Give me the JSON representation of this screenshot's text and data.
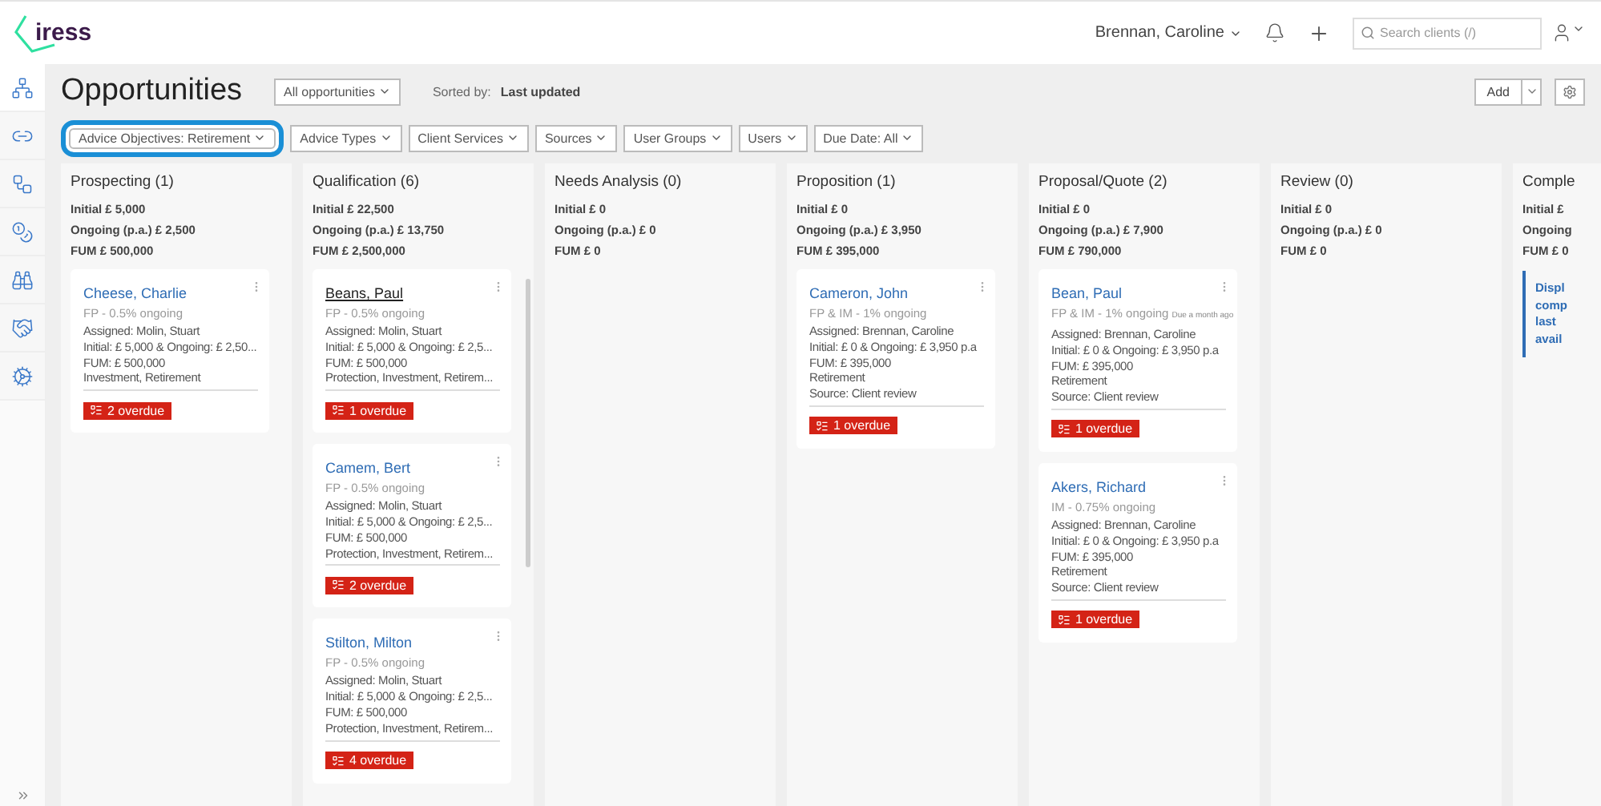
{
  "header": {
    "logo": "iress",
    "user": "Brennan, Caroline",
    "search": {
      "placeholder": "Search clients (/)"
    }
  },
  "title": "Opportunities",
  "view_select": "All opportunities",
  "sorted_label": "Sorted by:",
  "sorted_value": "Last updated",
  "add_button": "Add",
  "filters": [
    {
      "label": "Advice Objectives: Retirement",
      "highlighted": true
    },
    {
      "label": "Advice Types",
      "highlighted": false
    },
    {
      "label": "Client Services",
      "highlighted": false
    },
    {
      "label": "Sources",
      "highlighted": false
    },
    {
      "label": "User Groups",
      "highlighted": false
    },
    {
      "label": "Users",
      "highlighted": false
    },
    {
      "label": "Due Date: All",
      "highlighted": false
    }
  ],
  "columns": [
    {
      "title": "Prospecting (1)",
      "totals": [
        "Initial £ 5,000",
        "Ongoing (p.a.) £ 2,500",
        "FUM £ 500,000"
      ],
      "scrollbar": false,
      "cards": [
        {
          "name": "Cheese, Charlie",
          "hovered": false,
          "subtitle": "FP - 0.5% ongoing",
          "lines": [
            "Assigned: Molin, Stuart",
            "Initial: £ 5,000 & Ongoing: £ 2,50...",
            "FUM: £ 500,000",
            "Investment, Retirement"
          ],
          "overdue": "2 overdue"
        }
      ]
    },
    {
      "title": "Qualification (6)",
      "totals": [
        "Initial £ 22,500",
        "Ongoing (p.a.) £ 13,750",
        "FUM £ 2,500,000"
      ],
      "scrollbar": true,
      "cards": [
        {
          "name": "Beans, Paul",
          "hovered": true,
          "subtitle": "FP - 0.5% ongoing",
          "lines": [
            "Assigned: Molin, Stuart",
            "Initial: £ 5,000 & Ongoing: £ 2,5...",
            "FUM: £ 500,000",
            "Protection, Investment, Retirem..."
          ],
          "overdue": "1 overdue"
        },
        {
          "name": "Camem, Bert",
          "hovered": false,
          "subtitle": "FP - 0.5% ongoing",
          "lines": [
            "Assigned: Molin, Stuart",
            "Initial: £ 5,000 & Ongoing: £ 2,5...",
            "FUM: £ 500,000",
            "Protection, Investment, Retirem..."
          ],
          "overdue": "2 overdue"
        },
        {
          "name": "Stilton, Milton",
          "hovered": false,
          "subtitle": "FP - 0.5% ongoing",
          "lines": [
            "Assigned: Molin, Stuart",
            "Initial: £ 5,000 & Ongoing: £ 2,5...",
            "FUM: £ 500,000",
            "Protection, Investment, Retirem..."
          ],
          "overdue": "4 overdue"
        }
      ]
    },
    {
      "title": "Needs Analysis (0)",
      "totals": [
        "Initial £ 0",
        "Ongoing (p.a.) £ 0",
        "FUM £ 0"
      ],
      "scrollbar": false
    },
    {
      "title": "Proposition (1)",
      "totals": [
        "Initial £ 0",
        "Ongoing (p.a.) £ 3,950",
        "FUM £ 395,000"
      ],
      "scrollbar": false,
      "cards": [
        {
          "name": "Cameron, John",
          "hovered": false,
          "subtitle": "FP & IM - 1% ongoing",
          "lines": [
            "Assigned: Brennan, Caroline",
            "Initial: £ 0 & Ongoing: £ 3,950 p.a",
            "FUM: £ 395,000",
            "Retirement",
            "Source: Client review"
          ],
          "overdue": "1 overdue"
        }
      ]
    },
    {
      "title": "Proposal/Quote (2)",
      "totals": [
        "Initial £ 0",
        "Ongoing (p.a.) £ 7,900",
        "FUM £ 790,000"
      ],
      "scrollbar": false,
      "cards": [
        {
          "name": "Bean, Paul",
          "hovered": false,
          "subtitle": "FP & IM - 1% ongoing",
          "due": "Due a month ago",
          "lines": [
            "Assigned: Brennan, Caroline",
            "Initial: £ 0 & Ongoing: £ 3,950 p.a",
            "FUM: £ 395,000",
            "Retirement",
            "Source: Client review"
          ],
          "overdue": "1 overdue"
        },
        {
          "name": "Akers, Richard",
          "hovered": false,
          "subtitle": "IM - 0.75% ongoing",
          "lines": [
            "Assigned: Brennan, Caroline",
            "Initial: £ 0 & Ongoing: £ 3,950 p.a",
            "FUM: £ 395,000",
            "Retirement",
            "Source: Client review"
          ],
          "overdue": "1 overdue"
        }
      ]
    },
    {
      "title": "Review (0)",
      "totals": [
        "Initial £ 0",
        "Ongoing (p.a.) £ 0",
        "FUM £ 0"
      ],
      "scrollbar": false
    },
    {
      "title": "Comple",
      "totals": [
        "Initial £",
        "Ongoing",
        "FUM £ 0"
      ],
      "scrollbar": false,
      "notice": [
        "Displ",
        "comp",
        "last",
        "avail"
      ]
    }
  ]
}
